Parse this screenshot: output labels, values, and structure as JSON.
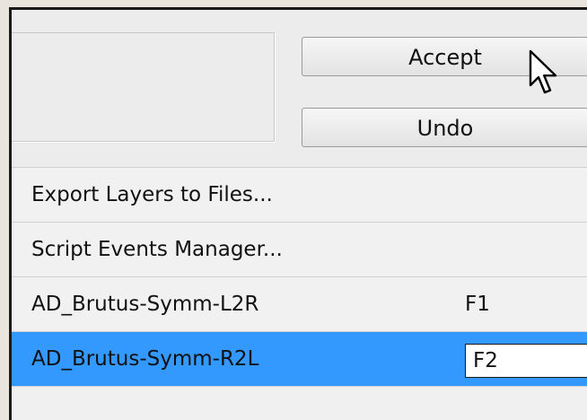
{
  "buttons": {
    "accept_label": "Accept",
    "undo_label": "Undo"
  },
  "menu": {
    "items": [
      {
        "label": "Export Layers to Files...",
        "shortcut": ""
      },
      {
        "label": "Script Events Manager...",
        "shortcut": ""
      },
      {
        "label": "AD_Brutus-Symm-L2R",
        "shortcut": "F1"
      },
      {
        "label": "AD_Brutus-Symm-R2L",
        "shortcut": "F2",
        "selected": true
      }
    ]
  },
  "colors": {
    "selection": "#3399ff",
    "panel": "#f0f0f0"
  },
  "icons": {
    "cursor": "arrow-cursor-icon"
  }
}
